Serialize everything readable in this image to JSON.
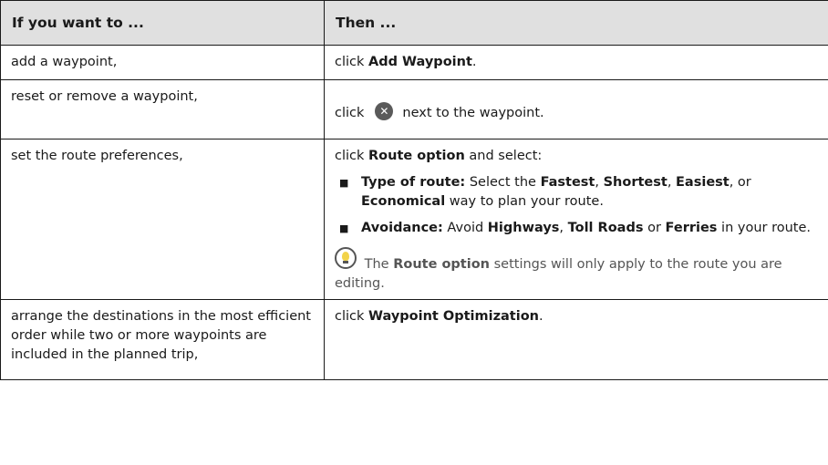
{
  "header": {
    "col1": "If you want to ...",
    "col2": "Then ..."
  },
  "rows": [
    {
      "action": "add a waypoint,",
      "then_prefix": "click",
      "then_bold": "Add Waypoint",
      "then_suffix": "."
    },
    {
      "action": "reset or remove a waypoint,",
      "then_prefix": "click",
      "icon": "close-circle-icon",
      "then_suffix": "next to the waypoint."
    },
    {
      "action": "set the route preferences,",
      "then_prefix": "click",
      "then_bold": "Route option",
      "then_suffix": "and select:",
      "bullet_glyph": "■",
      "bullets": [
        {
          "label": "Type of route:",
          "t1": "Select the",
          "b1": "Fastest",
          "t2": ",",
          "b2": "Shortest",
          "t3": ",",
          "b3": "Easiest",
          "t4": ", or",
          "b4": "Economical",
          "t5": "way to plan your route."
        },
        {
          "label": "Avoidance:",
          "t1": "Avoid",
          "b1": "Highways",
          "t2": ",",
          "b2": "Toll Roads",
          "t3": "or",
          "b3": "Ferries",
          "t4": "in your route."
        }
      ],
      "note": {
        "icon": "tip-lightbulb-icon",
        "prefix": "The",
        "bold": "Route option",
        "suffix": "settings will only apply to the route you are editing."
      }
    },
    {
      "action": "arrange the destinations in the most efficient order while two or more waypoints are included in the planned trip,",
      "then_prefix": "click",
      "then_bold": "Waypoint Optimization",
      "then_suffix": "."
    }
  ]
}
